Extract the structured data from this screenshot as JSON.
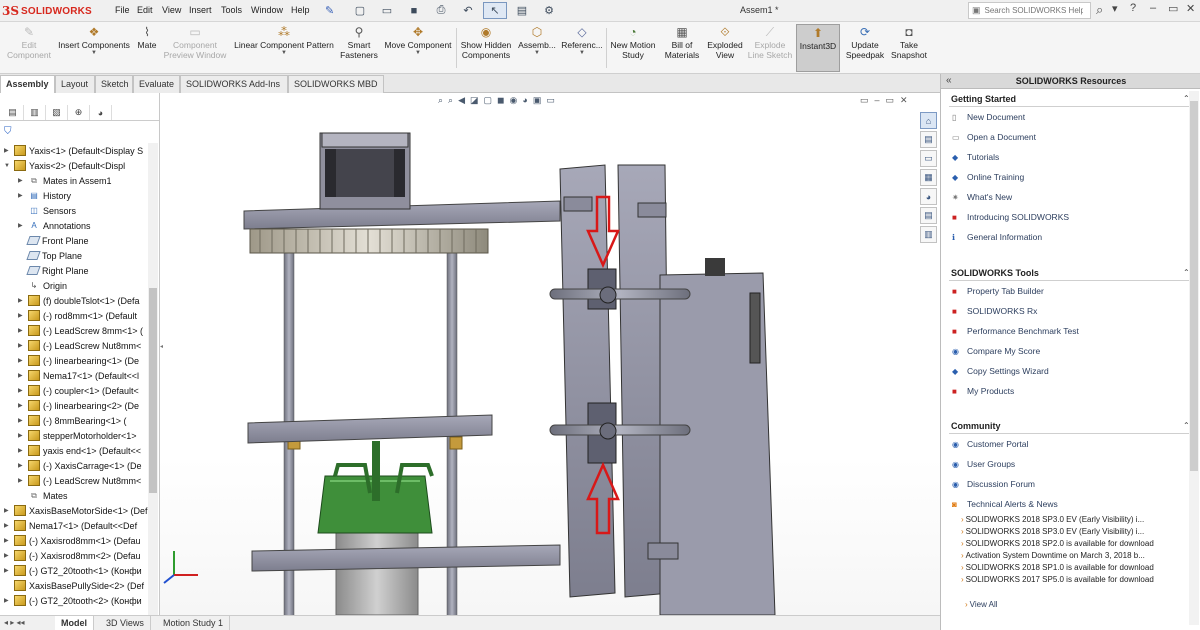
{
  "app": {
    "logo_text": "SOLIDWORKS",
    "logo_mark": "3S",
    "document_title": "Assem1 *"
  },
  "menu": [
    "File",
    "Edit",
    "View",
    "Insert",
    "Tools",
    "Window",
    "Help"
  ],
  "help_search": {
    "placeholder": "Search SOLIDWORKS Help"
  },
  "commands": [
    {
      "label": "Edit\nComponent",
      "enabled": false
    },
    {
      "label": "Insert Components",
      "enabled": true
    },
    {
      "label": "Mate",
      "enabled": true
    },
    {
      "label": "Component\nPreview Window",
      "enabled": false
    },
    {
      "label": "Linear Component Pattern",
      "enabled": true
    },
    {
      "label": "Smart\nFasteners",
      "enabled": true
    },
    {
      "label": "Move Component",
      "enabled": true
    },
    {
      "label": "Show Hidden\nComponents",
      "enabled": true
    },
    {
      "label": "Assemb...",
      "enabled": true
    },
    {
      "label": "Referenc...",
      "enabled": true
    },
    {
      "label": "New Motion\nStudy",
      "enabled": true
    },
    {
      "label": "Bill of\nMaterials",
      "enabled": true
    },
    {
      "label": "Exploded\nView",
      "enabled": true
    },
    {
      "label": "Explode\nLine Sketch",
      "enabled": false
    },
    {
      "label": "Instant3D",
      "enabled": true,
      "active": true
    },
    {
      "label": "Update\nSpeedpak",
      "enabled": true
    },
    {
      "label": "Take\nSnapshot",
      "enabled": true
    }
  ],
  "tabs": [
    "Assembly",
    "Layout",
    "Sketch",
    "Evaluate",
    "SOLIDWORKS Add-Ins",
    "SOLIDWORKS MBD"
  ],
  "active_tab": "Assembly",
  "feature_tree": [
    {
      "label": "Yaxis<1> (Default<Display S",
      "icon": "assembly-icon",
      "expander": "collapsed",
      "level": 0
    },
    {
      "label": "Yaxis<2> (Default<Displ",
      "icon": "assembly-icon",
      "expander": "expanded",
      "level": 0
    },
    {
      "label": "Mates in Assem1",
      "icon": "mates-icon",
      "expander": "collapsed",
      "level": 1
    },
    {
      "label": "History",
      "icon": "history-icon",
      "expander": "collapsed",
      "level": 1
    },
    {
      "label": "Sensors",
      "icon": "sensors-icon",
      "expander": "",
      "level": 1
    },
    {
      "label": "Annotations",
      "icon": "annotations-icon",
      "expander": "collapsed",
      "level": 1
    },
    {
      "label": "Front Plane",
      "icon": "plane-icon",
      "expander": "",
      "level": 1
    },
    {
      "label": "Top Plane",
      "icon": "plane-icon",
      "expander": "",
      "level": 1
    },
    {
      "label": "Right Plane",
      "icon": "plane-icon",
      "expander": "",
      "level": 1
    },
    {
      "label": "Origin",
      "icon": "origin-icon",
      "expander": "",
      "level": 1
    },
    {
      "label": "(f) doubleTslot<1> (Defa",
      "icon": "part-icon",
      "expander": "collapsed",
      "level": 1
    },
    {
      "label": "(-) rod8mm<1> (Default",
      "icon": "part-icon",
      "expander": "collapsed",
      "level": 1
    },
    {
      "label": "(-) LeadScrew 8mm<1> (",
      "icon": "part-icon",
      "expander": "collapsed",
      "level": 1
    },
    {
      "label": "(-) LeadScrew Nut8mm<",
      "icon": "part-icon",
      "expander": "collapsed",
      "level": 1
    },
    {
      "label": "(-) linearbearing<1> (De",
      "icon": "part-icon",
      "expander": "collapsed",
      "level": 1
    },
    {
      "label": "Nema17<1> (Default<<l",
      "icon": "part-icon",
      "expander": "collapsed",
      "level": 1
    },
    {
      "label": "(-) coupler<1> (Default<",
      "icon": "part-icon",
      "expander": "collapsed",
      "level": 1
    },
    {
      "label": "(-) linearbearing<2> (De",
      "icon": "part-icon",
      "expander": "collapsed",
      "level": 1
    },
    {
      "label": "(-) 8mmBearing<1> (",
      "icon": "assembly-icon",
      "expander": "collapsed",
      "level": 1
    },
    {
      "label": "stepperMotorholder<1>",
      "icon": "part-icon",
      "expander": "collapsed",
      "level": 1
    },
    {
      "label": "yaxis end<1> (Default<<",
      "icon": "part-icon",
      "expander": "collapsed",
      "level": 1
    },
    {
      "label": "(-) XaxisCarrage<1> (De",
      "icon": "part-icon",
      "expander": "collapsed",
      "level": 1
    },
    {
      "label": "(-) LeadScrew Nut8mm<",
      "icon": "part-icon",
      "expander": "collapsed",
      "level": 1
    },
    {
      "label": "Mates",
      "icon": "mates-icon",
      "expander": "",
      "level": 1
    },
    {
      "label": "XaxisBaseMotorSide<1> (Def",
      "icon": "part-icon",
      "expander": "collapsed",
      "level": 0
    },
    {
      "label": "Nema17<1> (Default<<Def",
      "icon": "part-icon",
      "expander": "collapsed",
      "level": 0
    },
    {
      "label": "(-) Xaxisrod8mm<1> (Defau",
      "icon": "part-icon",
      "expander": "collapsed",
      "level": 0
    },
    {
      "label": "(-) Xaxisrod8mm<2> (Defau",
      "icon": "part-icon",
      "expander": "collapsed",
      "level": 0
    },
    {
      "label": "(-) GT2_20tooth<1> (Конфи",
      "icon": "part-icon",
      "expander": "collapsed",
      "level": 0
    },
    {
      "label": "XaxisBasePullySide<2> (Def",
      "icon": "part-icon",
      "expander": "",
      "level": 0
    },
    {
      "label": "(-) GT2_20tooth<2> (Конфи",
      "icon": "part-icon",
      "expander": "collapsed",
      "level": 0
    }
  ],
  "bottom_tabs": [
    "Model",
    "3D Views",
    "Motion Study 1"
  ],
  "active_bottom_tab": "Model",
  "resources": {
    "title": "SOLIDWORKS Resources",
    "getting_started": {
      "title": "Getting Started",
      "items": [
        "New Document",
        "Open a Document",
        "Tutorials",
        "Online Training",
        "What's New",
        "Introducing SOLIDWORKS",
        "General Information"
      ]
    },
    "tools": {
      "title": "SOLIDWORKS Tools",
      "items": [
        "Property Tab Builder",
        "SOLIDWORKS Rx",
        "Performance Benchmark Test",
        "Compare My Score",
        "Copy Settings Wizard",
        "My Products"
      ]
    },
    "community": {
      "title": "Community",
      "items": [
        "Customer Portal",
        "User Groups",
        "Discussion Forum",
        "Technical Alerts & News"
      ],
      "news": [
        "SOLIDWORKS 2018 SP3.0 EV (Early Visibility) i...",
        "SOLIDWORKS 2018 SP3.0 EV (Early Visibility) i...",
        "SOLIDWORKS 2018 SP2.0 is available for download",
        "Activation System Downtime on March 3, 2018 b...",
        "SOLIDWORKS 2018 SP1.0 is available for download",
        "SOLIDWORKS 2017 SP5.0 is available for download"
      ],
      "view_all": "View All"
    }
  },
  "colors": {
    "accent_red": "#d7281e",
    "link_blue": "#2c3e5e",
    "model_gray": "#8e8f9e",
    "arrow_red": "#d81818"
  }
}
